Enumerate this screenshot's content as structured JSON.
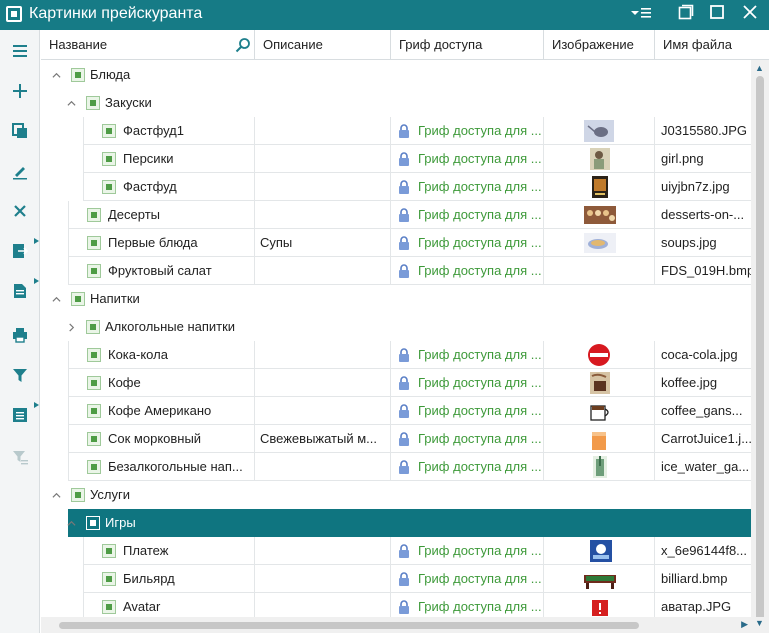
{
  "window": {
    "title": "Картинки прейскуранта",
    "accent": "#167b86",
    "controls": [
      "menu-icon",
      "restore-icon",
      "maximize-icon",
      "close-icon"
    ]
  },
  "toolbar": {
    "buttons": [
      {
        "icon": "hamburger-menu-icon"
      },
      {
        "icon": "add-icon"
      },
      {
        "icon": "copy-icon"
      },
      {
        "icon": "edit-icon"
      },
      {
        "icon": "delete-icon"
      },
      {
        "icon": "export-icon",
        "submenu": true
      },
      {
        "icon": "document-icon",
        "submenu": true
      },
      {
        "icon": "print-icon"
      },
      {
        "icon": "filter-icon"
      },
      {
        "icon": "list-icon",
        "submenu": true
      },
      {
        "icon": "clear-filter-icon",
        "disabled": true
      }
    ]
  },
  "columns": [
    {
      "key": "name",
      "label": "Название"
    },
    {
      "key": "description",
      "label": "Описание"
    },
    {
      "key": "access",
      "label": "Гриф доступа"
    },
    {
      "key": "image",
      "label": "Изображение"
    },
    {
      "key": "file",
      "label": "Имя файла"
    }
  ],
  "rows": [
    {
      "type": "group",
      "level": 0,
      "expanded": true,
      "name": "Блюда"
    },
    {
      "type": "group",
      "level": 1,
      "expanded": true,
      "name": "Закуски"
    },
    {
      "type": "item",
      "level": 2,
      "name": "Фастфуд1",
      "description": "",
      "access": "Гриф доступа для ...",
      "image": "mouse-thumbnail",
      "file": "J0315580.JPG"
    },
    {
      "type": "item",
      "level": 2,
      "name": "Персики",
      "description": "",
      "access": "Гриф доступа для ...",
      "image": "girl-thumbnail",
      "file": "girl.png"
    },
    {
      "type": "item",
      "level": 2,
      "name": "Фастфуд",
      "description": "",
      "access": "Гриф доступа для ...",
      "image": "poster-thumbnail",
      "file": "uiyjbn7z.jpg"
    },
    {
      "type": "item",
      "level": 1,
      "name": "Десерты",
      "description": "",
      "access": "Гриф доступа для ...",
      "image": "desserts-thumbnail",
      "file": "desserts-on-..."
    },
    {
      "type": "item",
      "level": 1,
      "name": "Первые блюда",
      "description": "Супы",
      "access": "Гриф доступа для ...",
      "image": "soups-thumbnail",
      "file": "soups.jpg"
    },
    {
      "type": "item",
      "level": 1,
      "name": "Фруктовый салат",
      "description": "",
      "access": "Гриф доступа для ...",
      "image": "",
      "file": "FDS_019H.bmp"
    },
    {
      "type": "group",
      "level": 0,
      "expanded": true,
      "name": "Напитки"
    },
    {
      "type": "group",
      "level": 1,
      "expanded": false,
      "name": "Алкогольные напитки"
    },
    {
      "type": "item",
      "level": 1,
      "name": "Кока-кола",
      "description": "",
      "access": "Гриф доступа для ...",
      "image": "coca-cola-thumbnail",
      "file": "coca-cola.jpg"
    },
    {
      "type": "item",
      "level": 1,
      "name": "Кофе",
      "description": "",
      "access": "Гриф доступа для ...",
      "image": "coffee-thumbnail",
      "file": "koffee.jpg"
    },
    {
      "type": "item",
      "level": 1,
      "name": "Кофе Американо",
      "description": "",
      "access": "Гриф доступа для ...",
      "image": "coffee-cup-thumbnail",
      "file": "coffee_gans..."
    },
    {
      "type": "item",
      "level": 1,
      "name": "Сок морковный",
      "description": "Свежевыжатый м...",
      "access": "Гриф доступа для ...",
      "image": "carrot-juice-thumbnail",
      "file": "CarrotJuice1.j..."
    },
    {
      "type": "item",
      "level": 1,
      "name": "Безалкогольные нап...",
      "description": "",
      "access": "Гриф доступа для ...",
      "image": "ice-water-thumbnail",
      "file": "ice_water_ga..."
    },
    {
      "type": "group",
      "level": 0,
      "expanded": true,
      "name": "Услуги"
    },
    {
      "type": "group",
      "level": 1,
      "expanded": true,
      "name": "Игры",
      "selected": true
    },
    {
      "type": "item",
      "level": 2,
      "name": "Платеж",
      "description": "",
      "access": "Гриф доступа для ...",
      "image": "card-thumbnail",
      "file": "x_6e96144f8..."
    },
    {
      "type": "item",
      "level": 2,
      "name": "Бильярд",
      "description": "",
      "access": "Гриф доступа для ...",
      "image": "billiard-thumbnail",
      "file": "billiard.bmp"
    },
    {
      "type": "item",
      "level": 2,
      "name": "Avatar",
      "description": "",
      "access": "Гриф доступа для ...",
      "image": "warning-thumbnail",
      "file": "аватар.JPG"
    }
  ],
  "colors": {
    "access_text": "#3e9a3a",
    "selection": "#0f7580",
    "toolbar_icons": "#1e7f8c"
  }
}
